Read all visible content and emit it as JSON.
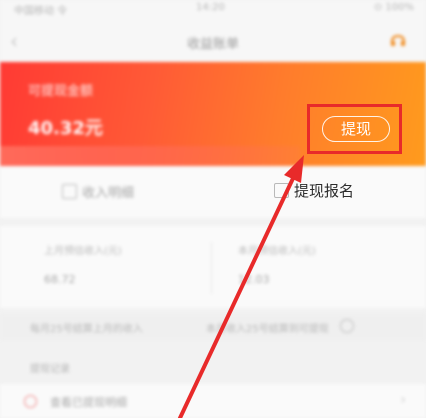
{
  "status_bar": {
    "carrier": "中国移动 令",
    "time": "14:20",
    "battery": "⊙ 100%"
  },
  "nav": {
    "back_icon": "back-arrow-icon",
    "title": "收益账单",
    "service_icon": "customer-service-icon"
  },
  "balance": {
    "label": "可提现金额",
    "amount": "40.32元",
    "withdraw_label": "提现"
  },
  "tabs": [
    {
      "label": "收入明细",
      "icon": "list-icon"
    },
    {
      "label": "提现报名",
      "icon": "document-icon"
    }
  ],
  "stats": [
    {
      "label": "上月预估收入(元)",
      "value": "68.72"
    },
    {
      "label": "本月预估收入(元)",
      "value": "12.03"
    }
  ],
  "notices": [
    "每月25号结算上月的收入",
    "本月收入25号结算到可提现"
  ],
  "section": {
    "title": "提现记录"
  },
  "list": [
    {
      "label": "查看已提现明细",
      "icon": "record-icon"
    }
  ],
  "colors": {
    "banner_start": "#ff3a34",
    "banner_end": "#ff9b1d",
    "annotation_red": "#e82a2a"
  }
}
